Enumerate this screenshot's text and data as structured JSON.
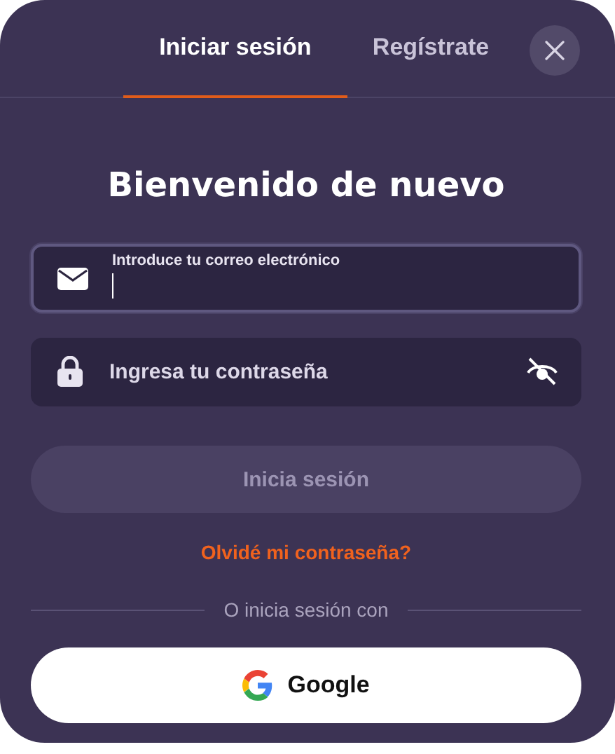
{
  "tabs": [
    {
      "label": "Iniciar sesión",
      "selected": true
    },
    {
      "label": "Regístrate",
      "selected": false
    }
  ],
  "heading": "Bienvenido de nuevo",
  "email_field": {
    "label": "Introduce tu correo electrónico",
    "focused": true
  },
  "password_field": {
    "placeholder": "Ingresa tu contraseña"
  },
  "login_button": {
    "label": "Inicia sesión",
    "disabled": true
  },
  "forgot_link": "Olvidé mi contraseña?",
  "divider_text": "O inicia sesión con",
  "social_buttons": [
    {
      "label": "Google"
    }
  ]
}
